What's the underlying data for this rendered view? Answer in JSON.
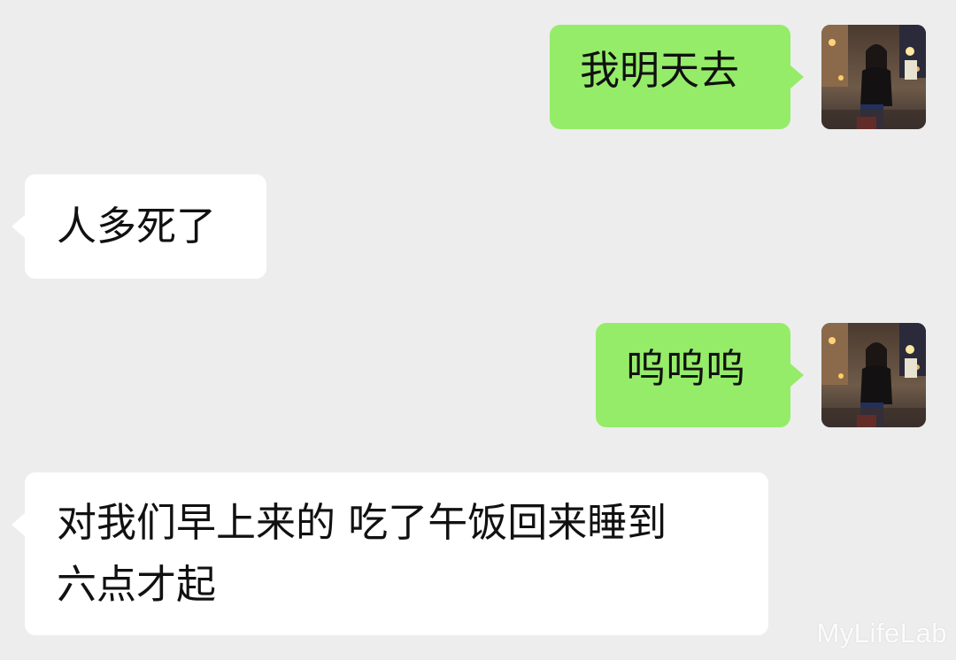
{
  "messages": [
    {
      "direction": "sent",
      "text": "我明天去"
    },
    {
      "direction": "received",
      "text": "人多死了"
    },
    {
      "direction": "sent",
      "text": "呜呜呜"
    },
    {
      "direction": "received",
      "lines": [
        "对我们早上来的 吃了午饭回来睡到",
        "六点才起"
      ]
    }
  ],
  "watermark": "MyLifeLab",
  "colors": {
    "background": "#ededed",
    "sent_bubble": "#95ec69",
    "received_bubble": "#ffffff",
    "text": "#111111"
  },
  "icons": {
    "avatar": "user-avatar-photo"
  }
}
